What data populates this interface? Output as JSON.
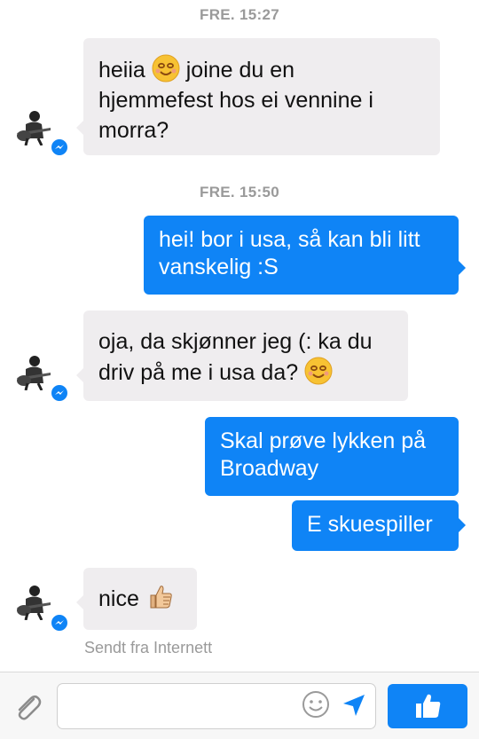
{
  "conversation": {
    "timestamps": [
      "FRE. 15:27",
      "FRE. 15:50"
    ],
    "messages": [
      {
        "from": "them",
        "lines": [
          "heiia",
          "joine du en",
          "hjemmefest hos ei vennine i",
          "morra?"
        ]
      },
      {
        "from": "me",
        "lines": [
          "hei! bor i usa, så kan bli litt",
          "vanskelig :S"
        ]
      },
      {
        "from": "them",
        "lines": [
          "oja, da skjønner jeg (: ka du",
          "driv på me i usa da?"
        ]
      },
      {
        "from": "me",
        "lines": [
          "Skal prøve lykken på",
          "Broadway"
        ]
      },
      {
        "from": "me",
        "lines": [
          "E skuespiller"
        ]
      },
      {
        "from": "them",
        "lines": [
          "nice"
        ]
      }
    ],
    "sent_note": "Sendt fra Internett"
  },
  "composer": {
    "placeholder": "",
    "icons": [
      "paperclip-icon",
      "smiley-icon",
      "send-arrow-icon",
      "thumbs-up-icon"
    ]
  },
  "colors": {
    "accent": "#0f84f6",
    "incoming_bubble": "#efedef",
    "timestamp": "#9a9a9a"
  }
}
